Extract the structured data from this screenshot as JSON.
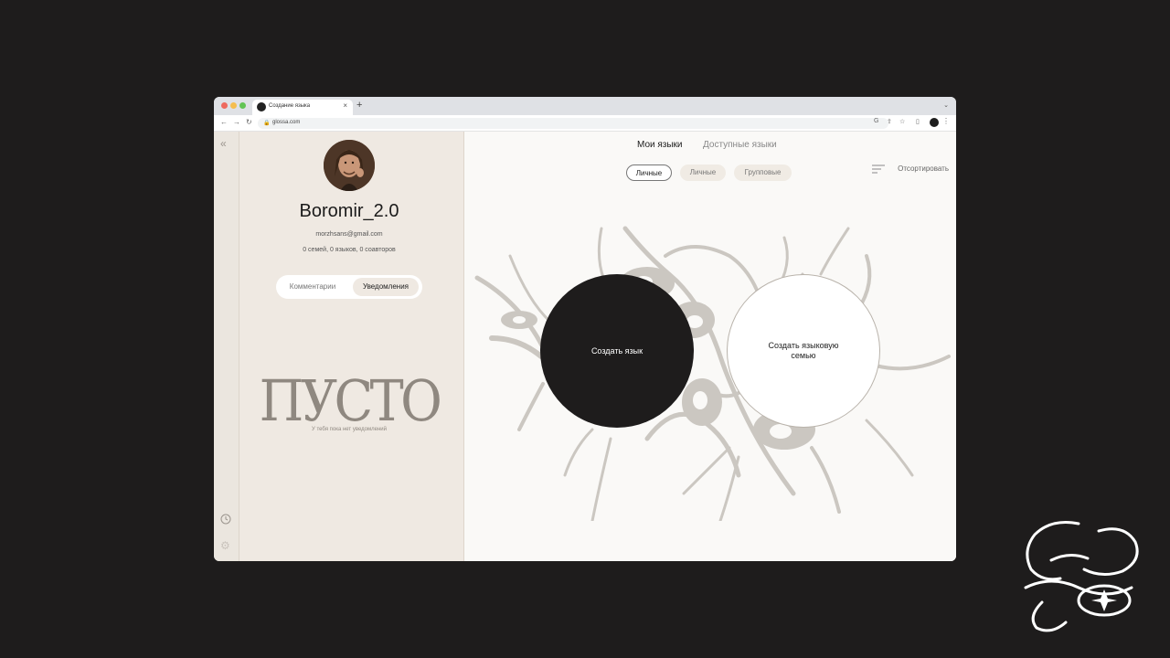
{
  "browser": {
    "tab_title": "Создание языка",
    "url": "glossa.com"
  },
  "profile": {
    "username": "Boromir_2.0",
    "email": "morzhsans@gmail.com",
    "stats": "0 семей, 0 языков, 0 соавторов"
  },
  "sidebar_tabs": [
    {
      "label": "Комментарии"
    },
    {
      "label": "Уведомления"
    }
  ],
  "empty_state": {
    "title": "ПУСТО",
    "text": "У тебя пока нет уведомлений"
  },
  "main": {
    "tabs": [
      {
        "label": "Мои языки"
      },
      {
        "label": "Доступные языки"
      }
    ],
    "filters": [
      {
        "label": "Личные"
      },
      {
        "label": "Личные"
      },
      {
        "label": "Групповые"
      }
    ],
    "sort_label": "Отсортировать",
    "create_language": "Создать язык",
    "create_family": "Создать языковую семью"
  },
  "colors": {
    "sidebar_bg": "#efe9e2",
    "main_bg": "#faf9f7",
    "dark": "#1e1c1c",
    "network": "#cbc7c1"
  },
  "icons": [
    "chevrons-left-icon",
    "clock-icon",
    "gear-icon",
    "sort-icon",
    "lock-icon",
    "star-icon"
  ]
}
